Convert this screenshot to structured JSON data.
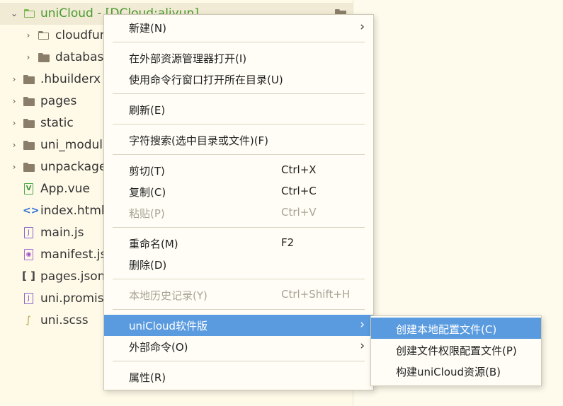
{
  "tree": {
    "items": [
      {
        "label": "uniCloud - [DCloud:aliyun]",
        "type": "folder-open"
      },
      {
        "label": "cloudfunctions",
        "type": "folder"
      },
      {
        "label": "database",
        "type": "folder"
      },
      {
        "label": ".hbuilderx",
        "type": "folder"
      },
      {
        "label": "pages",
        "type": "folder"
      },
      {
        "label": "static",
        "type": "folder"
      },
      {
        "label": "uni_modules",
        "type": "folder"
      },
      {
        "label": "unpackage",
        "type": "folder"
      },
      {
        "label": "App.vue",
        "type": "vue"
      },
      {
        "label": "index.html",
        "type": "html"
      },
      {
        "label": "main.js",
        "type": "js"
      },
      {
        "label": "manifest.json",
        "type": "manifest"
      },
      {
        "label": "pages.json",
        "type": "json"
      },
      {
        "label": "uni.promisify.adaptor.js",
        "type": "js"
      },
      {
        "label": "uni.scss",
        "type": "scss"
      }
    ]
  },
  "menu": {
    "items": [
      {
        "label": "新建(N)",
        "submenu": true
      },
      {
        "label": "在外部资源管理器打开(I)"
      },
      {
        "label": "使用命令行窗口打开所在目录(U)"
      },
      {
        "label": "刷新(E)"
      },
      {
        "label": "字符搜索(选中目录或文件)(F)"
      },
      {
        "label": "剪切(T)",
        "shortcut": "Ctrl+X"
      },
      {
        "label": "复制(C)",
        "shortcut": "Ctrl+C"
      },
      {
        "label": "粘贴(P)",
        "shortcut": "Ctrl+V",
        "disabled": true
      },
      {
        "label": "重命名(M)",
        "shortcut": "F2"
      },
      {
        "label": "删除(D)"
      },
      {
        "label": "本地历史记录(Y)",
        "shortcut": "Ctrl+Shift+H",
        "disabled": true
      },
      {
        "label": "uniCloud软件版",
        "submenu": true,
        "active": true
      },
      {
        "label": "外部命令(O)",
        "submenu": true
      },
      {
        "label": "属性(R)"
      }
    ]
  },
  "submenu": {
    "items": [
      {
        "label": "创建本地配置文件(C)",
        "active": true
      },
      {
        "label": "创建文件权限配置文件(P)"
      },
      {
        "label": "构建uniCloud资源(B)"
      }
    ]
  },
  "colors": {
    "background": "#fffae8",
    "accent": "#5a9be0",
    "folder": "#8a7e6a",
    "unicloud_green": "#4a9a2e"
  }
}
